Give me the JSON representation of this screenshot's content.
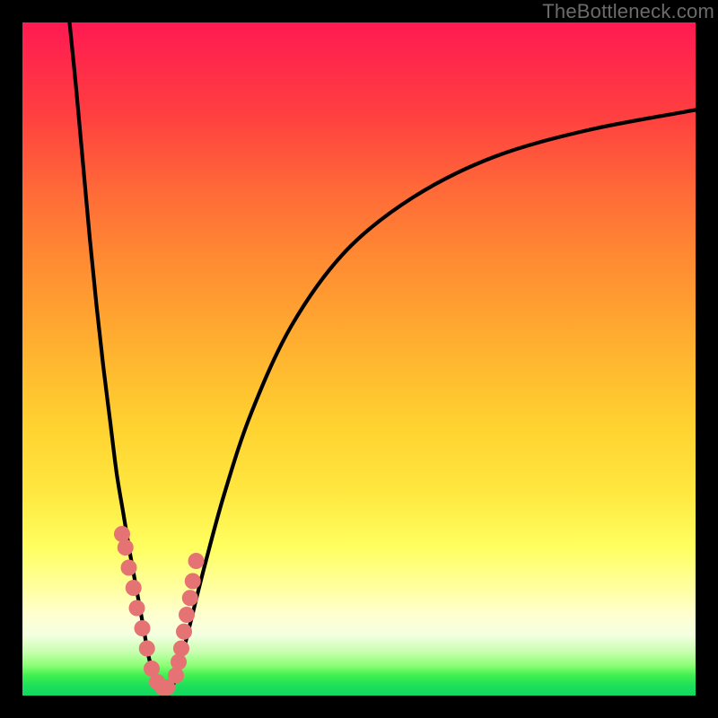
{
  "watermark": "TheBottleneck.com",
  "colors": {
    "curve": "#000000",
    "marker_fill": "#e57373",
    "marker_stroke": "#d86a6a",
    "background_black": "#000000"
  },
  "chart_data": {
    "type": "line",
    "title": "",
    "xlabel": "",
    "ylabel": "",
    "xlim": [
      0,
      100
    ],
    "ylim": [
      0,
      100
    ],
    "series": [
      {
        "name": "left-curve",
        "x": [
          7,
          8,
          9,
          10,
          11,
          12,
          13,
          14,
          15,
          16,
          17,
          18,
          18.7,
          19.5,
          20
        ],
        "y": [
          100,
          90,
          79,
          68,
          58,
          49,
          41,
          33,
          27,
          21,
          15.5,
          10,
          6,
          3,
          1
        ]
      },
      {
        "name": "right-curve",
        "x": [
          22,
          23,
          24,
          25,
          27,
          30,
          34,
          40,
          48,
          58,
          70,
          84,
          100
        ],
        "y": [
          1,
          3,
          7,
          11,
          19,
          30,
          42,
          55,
          66,
          74,
          80,
          84,
          87
        ]
      },
      {
        "name": "markers",
        "x": [
          14.8,
          15.3,
          15.8,
          16.5,
          17.0,
          17.8,
          18.5,
          19.2,
          20.0,
          20.8,
          21.5,
          22.8,
          23.2,
          23.6,
          24.0,
          24.4,
          24.9,
          25.3,
          25.8
        ],
        "y": [
          24,
          22,
          19,
          16,
          13,
          10,
          7,
          4,
          2,
          1.2,
          1.2,
          3,
          5,
          7,
          9.5,
          12,
          14.5,
          17,
          20
        ]
      }
    ],
    "gradient_stops": [
      {
        "pct": 0,
        "color": "#ff1a52"
      },
      {
        "pct": 25,
        "color": "#ff6a38"
      },
      {
        "pct": 60,
        "color": "#ffd230"
      },
      {
        "pct": 78,
        "color": "#ffff60"
      },
      {
        "pct": 95,
        "color": "#8cff76"
      },
      {
        "pct": 100,
        "color": "#12d860"
      }
    ]
  }
}
